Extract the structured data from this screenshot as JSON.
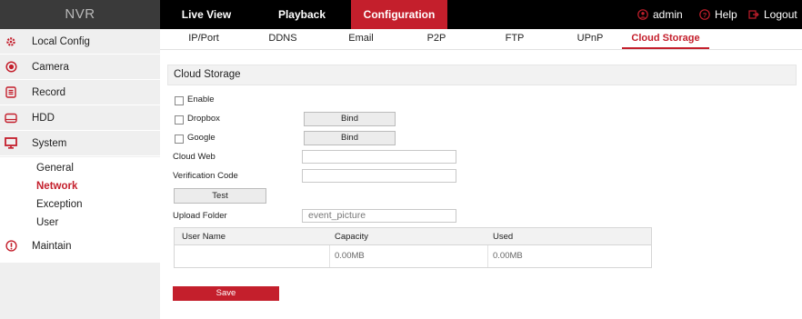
{
  "header": {
    "logo": "NVR",
    "tabs": [
      {
        "label": "Live View",
        "active": false
      },
      {
        "label": "Playback",
        "active": false
      },
      {
        "label": "Configuration",
        "active": true
      }
    ],
    "user": "admin",
    "help": "Help",
    "logout": "Logout"
  },
  "subnav": {
    "tabs": [
      "IP/Port",
      "DDNS",
      "Email",
      "P2P",
      "FTP",
      "UPnP",
      "Cloud Storage"
    ],
    "active": "Cloud Storage"
  },
  "sidebar": {
    "items": [
      {
        "label": "Local Config",
        "icon": "gear-icon"
      },
      {
        "label": "Camera",
        "icon": "camera-icon"
      },
      {
        "label": "Record",
        "icon": "record-icon"
      },
      {
        "label": "HDD",
        "icon": "hdd-icon"
      },
      {
        "label": "System",
        "icon": "monitor-icon"
      },
      {
        "label": "Maintain",
        "icon": "info-icon"
      }
    ],
    "system_sub": [
      "General",
      "Network",
      "Exception",
      "User"
    ],
    "active_sub": "Network"
  },
  "content": {
    "section_title": "Cloud Storage",
    "enable_label": "Enable",
    "dropbox_label": "Dropbox",
    "google_label": "Google",
    "bind_label": "Bind",
    "cloud_web_label": "Cloud Web",
    "cloud_web_value": "",
    "verification_label": "Verification Code",
    "verification_value": "",
    "test_label": "Test",
    "upload_folder_label": "Upload Folder",
    "upload_folder_value": "event_picture",
    "table": {
      "headers": [
        "User Name",
        "Capacity",
        "Used"
      ],
      "rows": [
        [
          "",
          "0.00MB",
          "0.00MB"
        ]
      ]
    },
    "save_label": "Save"
  },
  "colors": {
    "accent": "#c41f2c",
    "topbar": "#000000",
    "sidebar": "#efefef"
  }
}
